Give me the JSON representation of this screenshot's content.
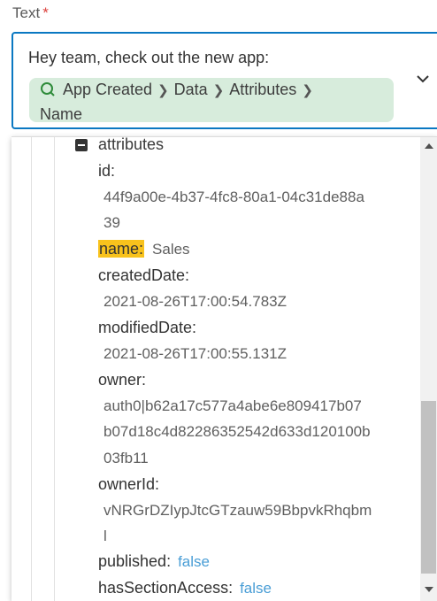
{
  "field": {
    "label": "Text",
    "required_marker": "*"
  },
  "editor": {
    "message": "Hey team, check out the new app:",
    "token": {
      "icon": "search-icon",
      "path": [
        "App Created",
        "Data",
        "Attributes",
        "Name"
      ]
    }
  },
  "tree": {
    "node": "attributes",
    "rows": [
      {
        "key": "id:",
        "value_lines": [
          "44f9a00e-4b37-4fc8-80a1-04c31de88a",
          "39"
        ]
      },
      {
        "key": "name:",
        "inline_value": "Sales",
        "highlighted": true
      },
      {
        "key": "createdDate:",
        "value_lines": [
          "2021-08-26T17:00:54.783Z"
        ]
      },
      {
        "key": "modifiedDate:",
        "value_lines": [
          "2021-08-26T17:00:55.131Z"
        ]
      },
      {
        "key": "owner:",
        "value_lines": [
          "auth0|b62a17c577a4abe6e809417b07",
          "b07d18c4d82286352542d633d120100b",
          "03fb11"
        ]
      },
      {
        "key": "ownerId:",
        "value_lines": [
          "vNRGrDZIypJtcGTzauw59BbpvkRhqbm",
          "l"
        ]
      },
      {
        "key": "published:",
        "inline_value": "false"
      },
      {
        "key": "hasSectionAccess:",
        "inline_value": "false"
      }
    ]
  },
  "colors": {
    "accent": "#0a78c2",
    "token_bg": "#d7ecdc",
    "highlight": "#f8c21c",
    "bool": "#4a9ed6",
    "required": "#dc423e"
  }
}
